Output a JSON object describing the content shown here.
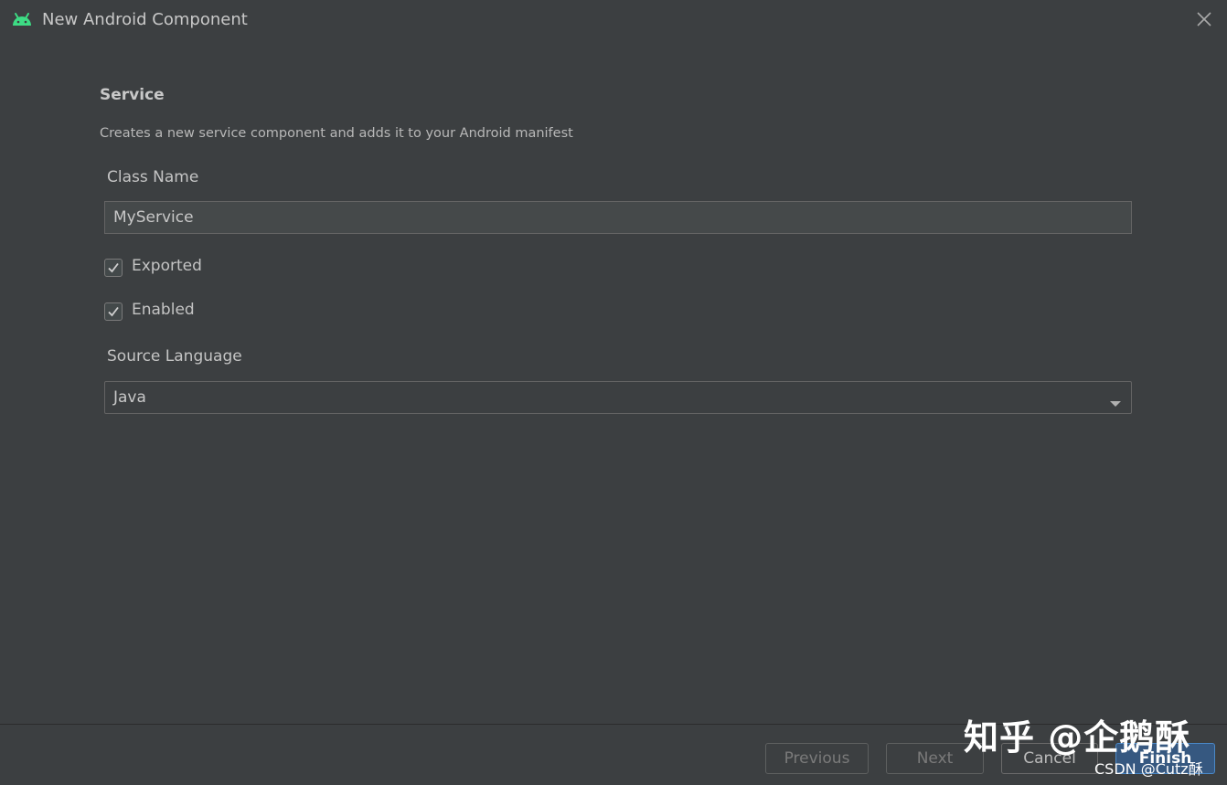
{
  "window": {
    "title": "New Android Component",
    "icon": "android-icon",
    "close_icon": "close-icon"
  },
  "form": {
    "section_title": "Service",
    "description": "Creates a new service component and adds it to your Android manifest",
    "class_name": {
      "label": "Class Name",
      "value": "MyService"
    },
    "exported": {
      "label": "Exported",
      "checked": true
    },
    "enabled": {
      "label": "Enabled",
      "checked": true
    },
    "source_language": {
      "label": "Source Language",
      "value": "Java",
      "icon": "chevron-down-icon"
    }
  },
  "footer": {
    "previous_label": "Previous",
    "next_label": "Next",
    "cancel_label": "Cancel",
    "finish_label": "Finish"
  },
  "watermark": {
    "main": "知乎 @企鹅酥",
    "sub": "CSDN @Cutz酥"
  },
  "colors": {
    "background": "#3c3f41",
    "android_green": "#3ddc84",
    "finish_button": "#365880",
    "finish_border": "#4a88c7"
  }
}
